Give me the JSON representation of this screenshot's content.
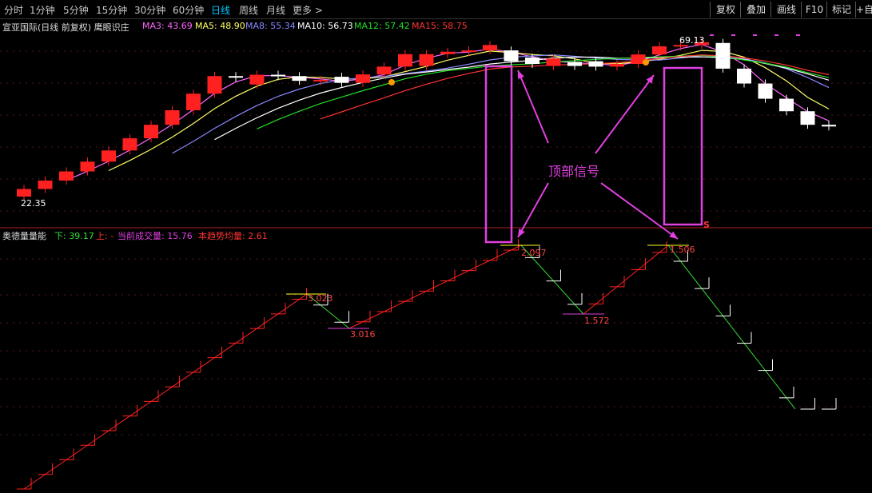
{
  "toolbar": {
    "periods": [
      "分时",
      "1分钟",
      "5分钟",
      "15分钟",
      "30分钟",
      "60分钟",
      "日线",
      "周线",
      "月线",
      "更多 >"
    ],
    "active_index": 6,
    "right_buttons": [
      "复权",
      "叠加",
      "画线",
      "F10",
      "标记",
      "+自"
    ]
  },
  "price_panel": {
    "title": "宣亚国际(日线 前复权) 鹰眼识庄",
    "ma_legend": [
      {
        "label": "MA3: 43.69",
        "color": "#ff66ff"
      },
      {
        "label": "MA5: 48.90",
        "color": "#ffff66"
      },
      {
        "label": "MA8: 55.34",
        "color": "#8888ff"
      },
      {
        "label": "MA10: 56.73",
        "color": "#ffffff"
      },
      {
        "label": "MA12: 57.42",
        "color": "#22dd22"
      },
      {
        "label": "MA15: 58.75",
        "color": "#ff3333"
      }
    ],
    "price_low_label": "22.35",
    "price_high_label": "69.13"
  },
  "indicator_panel": {
    "title": "奥德量量能",
    "down_label": "下: 39.17",
    "up_label": "上: -",
    "volume_label": "当前成交量: 15.76",
    "trend_label": "本趋势均量: 2.61",
    "annotations": [
      "3.023",
      "3.016",
      "2.097",
      "1.572",
      "1.506"
    ]
  },
  "overlay": {
    "signal_label": "顶部信号",
    "s_marker": "S"
  },
  "colors": {
    "up": "#ff2020",
    "down": "#00e0e0",
    "flat": "#ffffff",
    "yellow": "#ffff22",
    "magenta": "#e040e0"
  },
  "chart_data": {
    "type": "candlestick",
    "x": [
      1,
      2,
      3,
      4,
      5,
      6,
      7,
      8,
      9,
      10,
      11,
      12,
      13,
      14,
      15,
      16,
      17,
      18,
      19,
      20,
      21,
      22,
      23,
      24,
      25,
      26,
      27,
      28,
      29,
      30,
      31,
      32,
      33,
      34,
      35,
      36,
      37,
      38,
      39
    ],
    "open": [
      22.35,
      24.6,
      27.1,
      29.8,
      32.7,
      36.0,
      39.6,
      43.6,
      47.9,
      52.8,
      58.0,
      55.5,
      58.4,
      58.0,
      56.6,
      57.8,
      56.0,
      58.5,
      60.8,
      61.0,
      64.5,
      65.2,
      65.6,
      65.6,
      63.5,
      61.0,
      62.2,
      62.4,
      60.8,
      61.6,
      64.4,
      66.8,
      67.2,
      67.8,
      60.2,
      55.8,
      51.3,
      47.6,
      43.6
    ],
    "close": [
      24.6,
      27.1,
      29.8,
      32.7,
      36.0,
      39.6,
      43.6,
      47.9,
      52.8,
      58.0,
      58.0,
      58.4,
      58.0,
      56.6,
      56.9,
      56.0,
      58.5,
      60.8,
      64.5,
      64.5,
      65.2,
      65.6,
      67.2,
      62.4,
      61.6,
      63.2,
      61.0,
      60.8,
      61.6,
      64.4,
      66.8,
      67.2,
      68.0,
      60.2,
      55.8,
      51.3,
      47.6,
      43.6,
      43.1
    ],
    "ma_series": [
      "MA3",
      "MA5",
      "MA8",
      "MA10",
      "MA12",
      "MA15"
    ],
    "indicator_annotations": [
      3.023,
      3.016,
      2.097,
      1.572,
      1.506
    ]
  }
}
